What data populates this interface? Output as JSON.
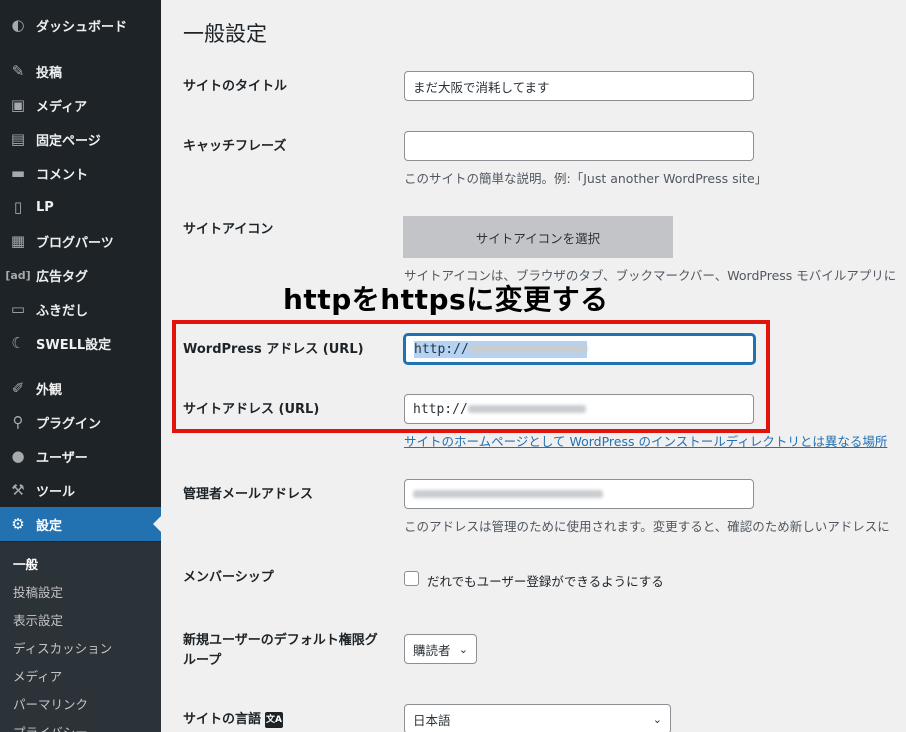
{
  "sidebar": {
    "items": [
      {
        "label": "ダッシュボード",
        "icon": "dashboard-icon",
        "glyph": "◐"
      },
      {
        "label": "投稿",
        "icon": "pin-icon",
        "glyph": "✎"
      },
      {
        "label": "メディア",
        "icon": "media-icon",
        "glyph": "▣"
      },
      {
        "label": "固定ページ",
        "icon": "page-icon",
        "glyph": "▤"
      },
      {
        "label": "コメント",
        "icon": "comment-icon",
        "glyph": "▬"
      },
      {
        "label": "LP",
        "icon": "document-icon",
        "glyph": "▯"
      },
      {
        "label": "ブログパーツ",
        "icon": "grid-icon",
        "glyph": "▦"
      },
      {
        "label": "広告タグ",
        "icon": "ad-icon",
        "glyph": "[ad]"
      },
      {
        "label": "ふきだし",
        "icon": "bubble-icon",
        "glyph": "▭"
      },
      {
        "label": "SWELL設定",
        "icon": "swell-icon",
        "glyph": "☾"
      },
      {
        "label": "外観",
        "icon": "brush-icon",
        "glyph": "✐"
      },
      {
        "label": "プラグイン",
        "icon": "plugin-icon",
        "glyph": "⚲"
      },
      {
        "label": "ユーザー",
        "icon": "user-icon",
        "glyph": "●"
      },
      {
        "label": "ツール",
        "icon": "wrench-icon",
        "glyph": "⚒"
      },
      {
        "label": "設定",
        "icon": "settings-icon",
        "glyph": "⚙"
      }
    ],
    "submenu": [
      "一般",
      "投稿設定",
      "表示設定",
      "ディスカッション",
      "メディア",
      "パーマリンク",
      "プライバシー"
    ]
  },
  "page": {
    "title": "一般設定",
    "site_title_label": "サイトのタイトル",
    "site_title_value": "まだ大阪で消耗してます",
    "tagline_label": "キャッチフレーズ",
    "tagline_value": "",
    "tagline_desc": "このサイトの簡単な説明。例:「Just another WordPress site」",
    "site_icon_label": "サイトアイコン",
    "site_icon_button": "サイトアイコンを選択",
    "site_icon_desc": "サイトアイコンは、ブラウザのタブ、ブックマークバー、WordPress モバイルアプリに",
    "annotation": "httpをhttpsに変更する",
    "wp_address_label": "WordPress アドレス (URL)",
    "wp_address_prefix": "http://",
    "site_address_label": "サイトアドレス (URL)",
    "site_address_prefix": "http://",
    "site_address_desc": "サイトのホームページとして WordPress のインストールディレクトリとは異なる場所",
    "admin_email_label": "管理者メールアドレス",
    "admin_email_desc": "このアドレスは管理のために使用されます。変更すると、確認のため新しいアドレスに",
    "membership_label": "メンバーシップ",
    "membership_checkbox": "だれでもユーザー登録ができるようにする",
    "default_role_label": "新規ユーザーのデフォルト権限グループ",
    "default_role_value": "購読者",
    "language_label": "サイトの言語",
    "language_value": "日本語"
  },
  "colors": {
    "sidebar_bg": "#1d2327",
    "accent": "#2271b1",
    "annotation_border": "#e3120b"
  }
}
